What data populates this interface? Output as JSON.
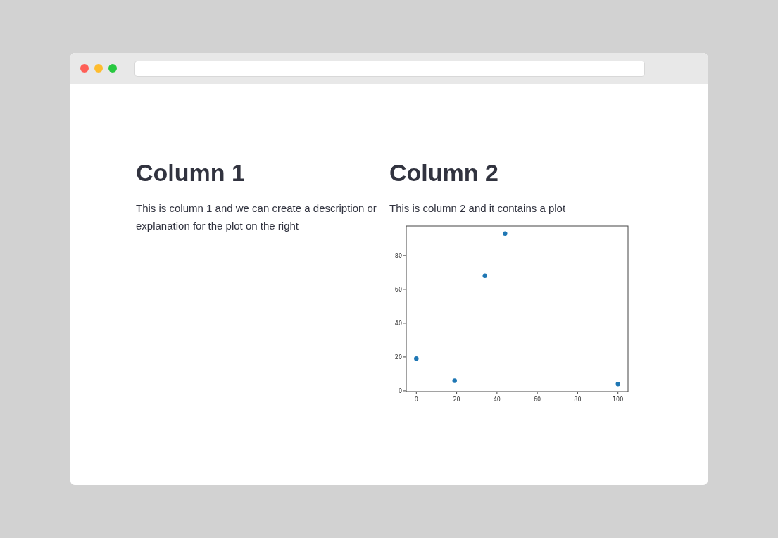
{
  "columns": [
    {
      "heading": "Column 1",
      "text": "This is column 1 and we can create a description or explanation for the plot on the right"
    },
    {
      "heading": "Column 2",
      "text": "This is column 2 and it contains a plot",
      "chart_data": {
        "type": "scatter",
        "x": [
          0,
          19,
          34,
          44,
          100
        ],
        "series": [
          {
            "color": "#1f77b4",
            "values": [
              19,
              6,
              68,
              93,
              4
            ]
          }
        ],
        "xlim": [
          -5,
          105
        ],
        "ylim": [
          -0.45,
          97.45
        ],
        "xticks": [
          0,
          20,
          40,
          60,
          80,
          100
        ],
        "yticks": [
          0,
          20,
          40,
          60,
          80
        ]
      }
    }
  ]
}
